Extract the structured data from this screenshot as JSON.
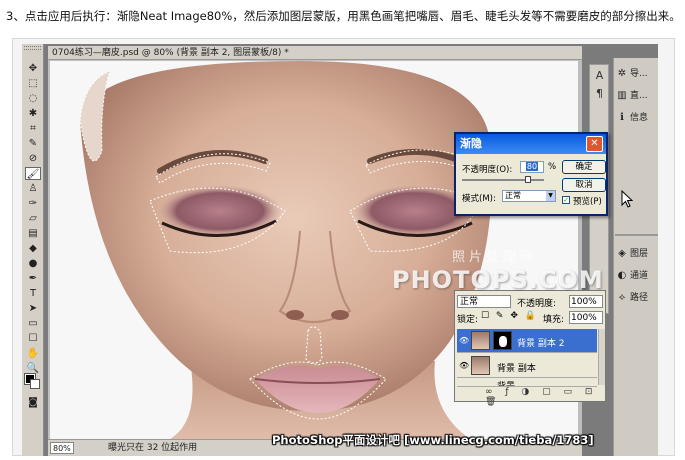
{
  "instruction": "3、点击应用后执行：渐隐Neat Image80%，然后添加图层蒙版，用黑色画笔把嘴唇、眉毛、睫毛头发等不需要磨皮的部分擦出来。",
  "document": {
    "title": "0704练习—磨皮.psd @ 80% (背景 副本 2, 图层蒙板/8) *",
    "zoom": "80%",
    "status": "曝光只在 32 位起作用"
  },
  "dialog": {
    "title": "渐隐",
    "opacity_label": "不透明度(O):",
    "opacity_value": "80",
    "opacity_unit": "%",
    "opacity_fraction": 0.8,
    "mode_label": "模式(M):",
    "mode_value": "正常",
    "ok_label": "确定",
    "cancel_label": "取消",
    "preview_label": "预览(P)",
    "preview_checked": true
  },
  "layers": {
    "blend_mode": "正常",
    "opacity_label": "不透明度:",
    "opacity_value": "100%",
    "lock_label": "锁定:",
    "fill_label": "填充:",
    "fill_value": "100%",
    "items": [
      {
        "name": "背景 副本 2",
        "active": true,
        "has_mask": true
      },
      {
        "name": "背景 副本",
        "active": false,
        "has_mask": false
      },
      {
        "name": "背景",
        "active": false,
        "has_mask": false
      }
    ]
  },
  "right_nav": {
    "items": [
      {
        "label": "导..."
      },
      {
        "label": "直..."
      },
      {
        "label": "信息"
      },
      {
        "label": "图层"
      },
      {
        "label": "通道"
      },
      {
        "label": "路径"
      }
    ]
  },
  "watermark": {
    "cn": "照片处理网",
    "en": "PHOTOPS.COM"
  },
  "credit": "PhotoShop平面设计吧 [www.linecg.com/tieba/1783]",
  "colors": {
    "titlebar": "#0a5adf",
    "selection": "#3a6fd0",
    "close": "#e0572e"
  }
}
